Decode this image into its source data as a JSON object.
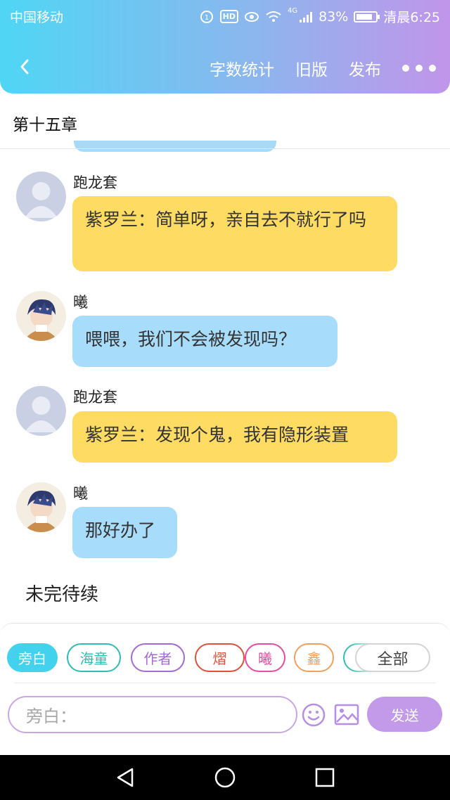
{
  "status_bar": {
    "carrier": "中国移动",
    "hd": "HD",
    "network": "4G",
    "battery": "83%",
    "time": "清晨6:25"
  },
  "nav": {
    "word_count": "字数统计",
    "old_version": "旧版",
    "publish": "发布"
  },
  "chapter": {
    "title": "第十五章"
  },
  "messages": [
    {
      "sender": "跑龙套",
      "text": "紫罗兰：简单呀，亲自去不就行了吗",
      "color": "#fedc64"
    },
    {
      "sender": "曦",
      "text": "喂喂，我们不会被发现吗？",
      "color": "#a8dcfb"
    },
    {
      "sender": "跑龙套",
      "text": "紫罗兰：发现个鬼，我有隐形装置",
      "color": "#fedc64"
    },
    {
      "sender": "曦",
      "text": "那好办了",
      "color": "#a8dcfb"
    }
  ],
  "to_be_continued": "未完待续",
  "roles": [
    {
      "label": "旁白",
      "color": "#42d2ee"
    },
    {
      "label": "海童",
      "color": "#2fbcb2"
    },
    {
      "label": "作者",
      "color": "#a46bd4"
    },
    {
      "label": "熠",
      "color": "#e0503c"
    },
    {
      "label": "曦",
      "color": "#e54ca0"
    },
    {
      "label": "鑫",
      "color": "#f0a060"
    }
  ],
  "all_roles": "全部",
  "composer": {
    "placeholder": "旁白：",
    "send": "发送"
  }
}
